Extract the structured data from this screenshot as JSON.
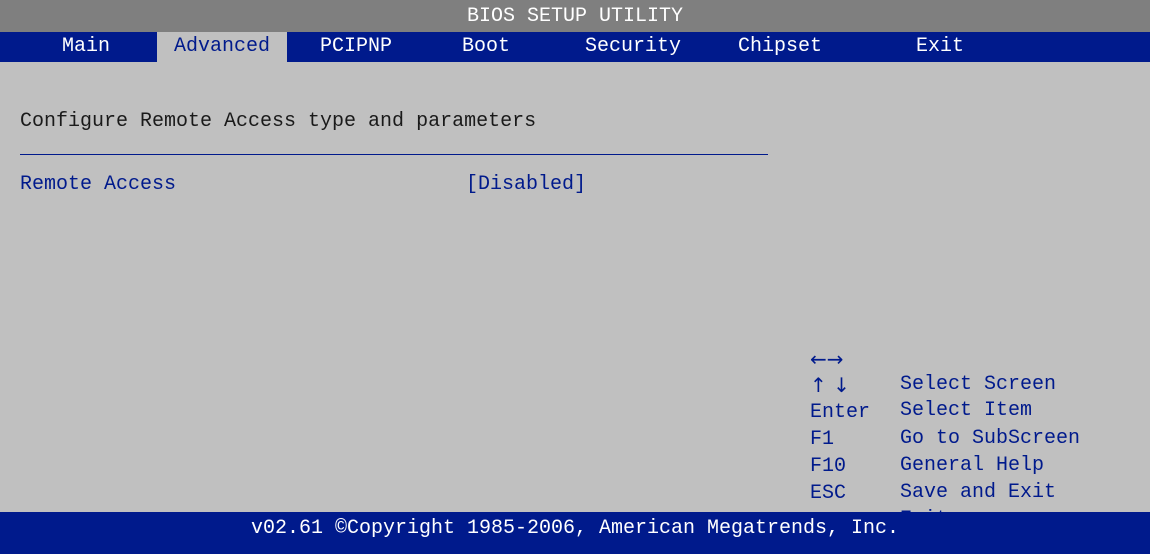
{
  "title": "BIOS SETUP UTILITY",
  "tabs": [
    {
      "label": "Main"
    },
    {
      "label": "Advanced",
      "active": true
    },
    {
      "label": "PCIPNP"
    },
    {
      "label": "Boot"
    },
    {
      "label": "Security"
    },
    {
      "label": "Chipset"
    },
    {
      "label": "Exit"
    }
  ],
  "content": {
    "description": "Configure Remote Access type and parameters",
    "option": {
      "label": "Remote Access",
      "value": "[Disabled]"
    }
  },
  "help": [
    {
      "key": "←→",
      "desc": "Select Screen"
    },
    {
      "key": "↑ ↓",
      "desc": "Select Item"
    },
    {
      "key": "Enter",
      "desc": "Go to SubScreen"
    },
    {
      "key": "F1",
      "desc": "General Help"
    },
    {
      "key": "F10",
      "desc": "Save and Exit"
    },
    {
      "key": "ESC",
      "desc": "Exit"
    }
  ],
  "footer": "v02.61 ©Copyright 1985-2006, American Megatrends, Inc.",
  "colors": {
    "title_bar": "#7f7f7f",
    "menu_bar": "#001a8c",
    "background": "#c0c0c0",
    "accent_text": "#001a8c"
  }
}
